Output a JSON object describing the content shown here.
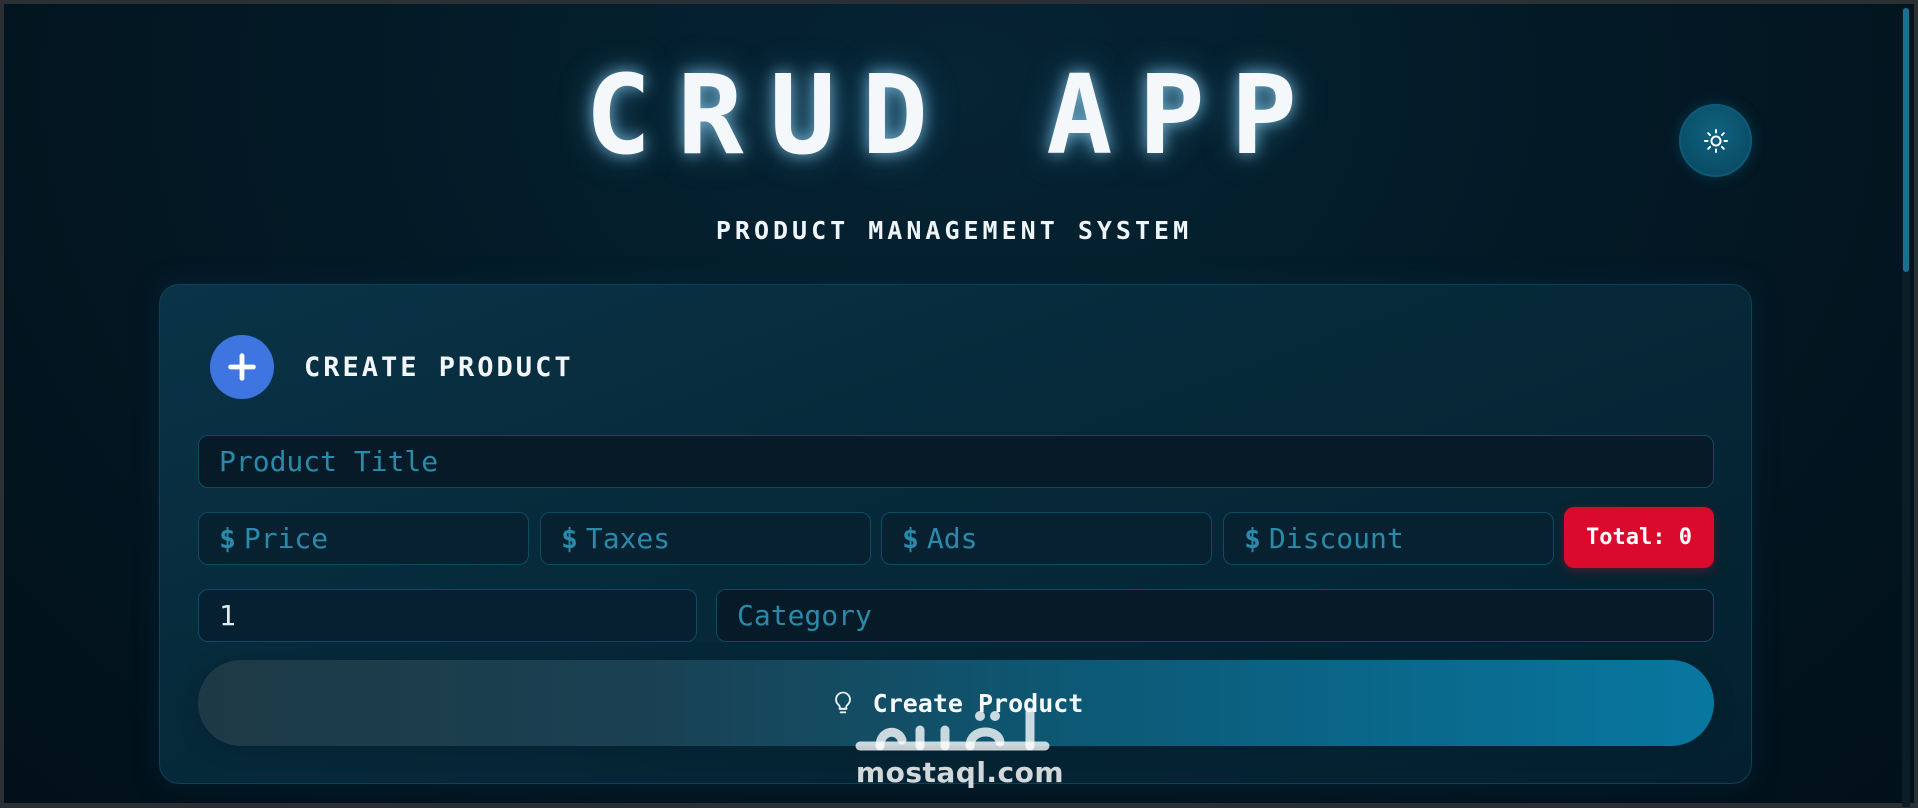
{
  "header": {
    "title": "CRUD APP",
    "subtitle": "PRODUCT MANAGEMENT SYSTEM",
    "theme_toggle_icon": "sun-icon"
  },
  "form": {
    "section_title": "CREATE PRODUCT",
    "section_icon": "plus-icon",
    "title_placeholder": "Product Title",
    "price_placeholder": "Price",
    "taxes_placeholder": "Taxes",
    "ads_placeholder": "Ads",
    "discount_placeholder": "Discount",
    "currency_symbol": "$",
    "total_label": "Total: 0",
    "count_value": "1",
    "category_placeholder": "Category",
    "submit_label": "Create Product",
    "submit_icon": "lightbulb-icon"
  },
  "watermark": {
    "text": "mostaql.com",
    "logo": "مستقل"
  },
  "colors": {
    "background": "#031a26",
    "accent_blue": "#3f75e0",
    "total_red": "#da0a2c",
    "placeholder": "#2b8aaa",
    "button_gradient_end": "#0877a0"
  }
}
